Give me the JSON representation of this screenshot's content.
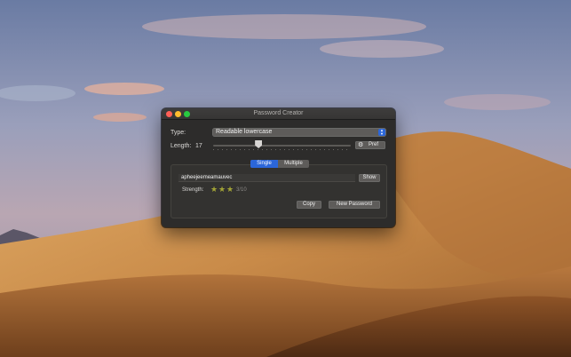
{
  "desktop": {
    "sky_top": "#6d7ea6",
    "sky_mid": "#b9a3ad",
    "dune_light": "#d09a55",
    "dune_dark": "#6b3d1b"
  },
  "window": {
    "title": "Password Creator",
    "type_label": "Type:",
    "type_value": "Readable lowercase",
    "length_label": "Length:",
    "length_value": "17",
    "length_level": 0.33,
    "pref_icon": "gear-icon",
    "pref_label": "Pref",
    "tabs": [
      "Single",
      "Multiple"
    ],
    "selected_tab": "Single",
    "password": "apheejeemeamauvec",
    "show_label": "Show",
    "strength_label": "Strength:",
    "strength_stars": 3,
    "strength_score": "3/10",
    "copy_label": "Copy",
    "new_password_label": "New Password",
    "accent": "#2b66d9"
  }
}
